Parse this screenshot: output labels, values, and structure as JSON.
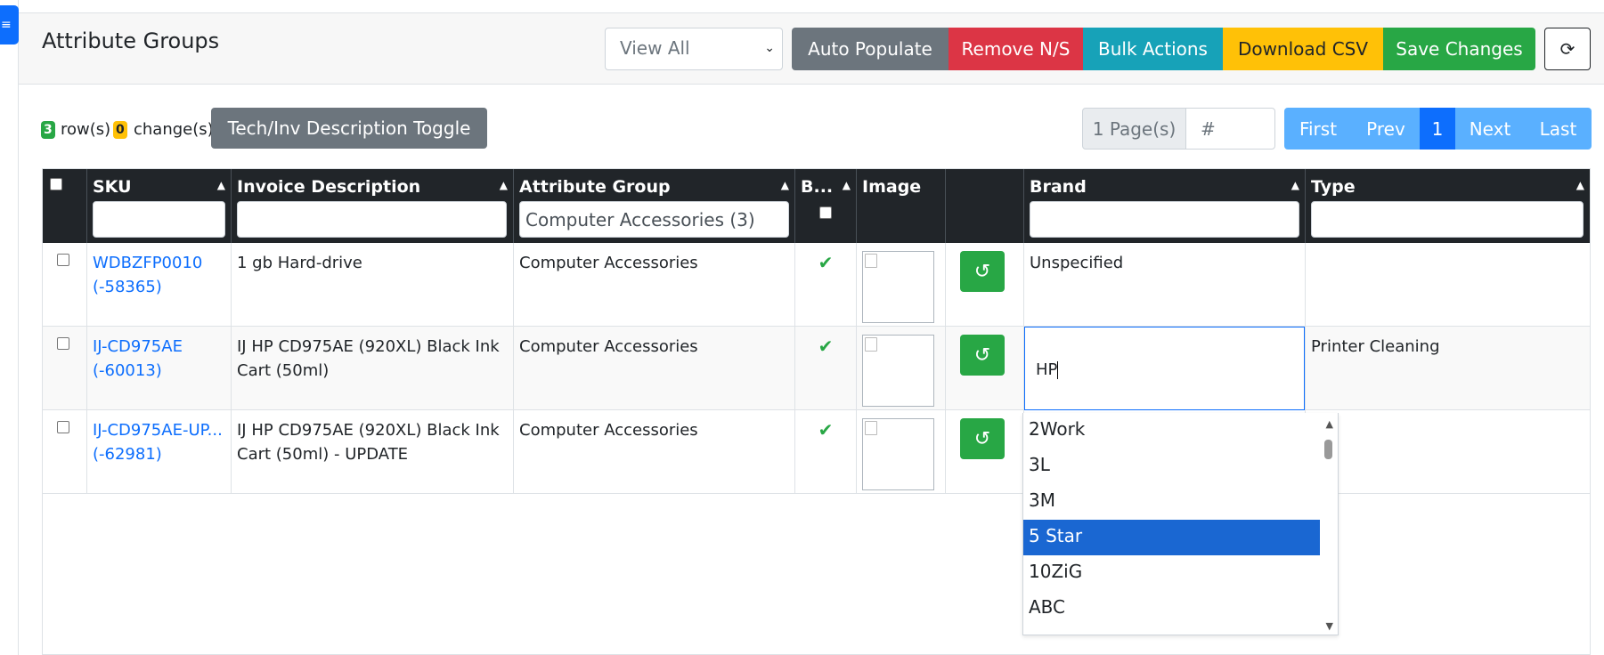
{
  "header": {
    "title": "Attribute Groups",
    "view_select": "View All",
    "buttons": {
      "auto_populate": "Auto Populate",
      "remove_ns": "Remove N/S",
      "bulk_actions": "Bulk Actions",
      "download_csv": "Download CSV",
      "save_changes": "Save Changes"
    }
  },
  "stats": {
    "rows_count": "3",
    "rows_label": "row(s)",
    "changes_count": "0",
    "changes_label": "change(s)",
    "toggle_label": "Tech/Inv Description Toggle"
  },
  "pagination": {
    "pages_label": "1 Page(s)",
    "page_input_placeholder": "#",
    "first": "First",
    "prev": "Prev",
    "current": "1",
    "next": "Next",
    "last": "Last"
  },
  "table": {
    "columns": {
      "sku": "SKU",
      "invoice_description": "Invoice Description",
      "attribute_group": "Attribute Group",
      "b": "B...",
      "image": "Image",
      "brand": "Brand",
      "type": "Type"
    },
    "filters": {
      "attribute_group": "Computer Accessories (3)"
    },
    "rows": [
      {
        "sku": "WDBZFP0010",
        "sku_id": "(-58365)",
        "invoice_description": "1 gb Hard-drive",
        "attribute_group": "Computer Accessories",
        "b": "✔",
        "brand": "Unspecified",
        "type": ""
      },
      {
        "sku": "IJ-CD975AE",
        "sku_id": "(-60013)",
        "invoice_description": "IJ HP CD975AE (920XL) Black Ink Cart (50ml)",
        "attribute_group": "Computer Accessories",
        "b": "✔",
        "brand": "HP",
        "type": "Printer Cleaning"
      },
      {
        "sku": "IJ-CD975AE-UP...",
        "sku_id": "(-62981)",
        "invoice_description": "IJ HP CD975AE (920XL) Black Ink Cart (50ml) - UPDATE",
        "attribute_group": "Computer Accessories",
        "b": "✔",
        "brand": "",
        "type": ""
      }
    ]
  },
  "brand_dropdown": {
    "options": [
      "2Work",
      "3L",
      "3M",
      "5 Star",
      "10ZiG",
      "ABC"
    ],
    "selected": "5 Star"
  }
}
